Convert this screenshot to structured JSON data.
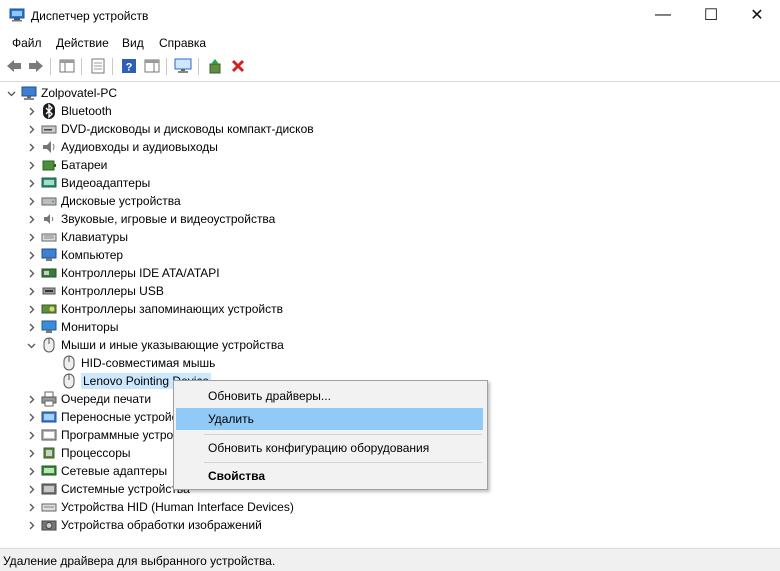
{
  "window": {
    "title": "Диспетчер устройств",
    "minimize": "—",
    "maximize": "☐",
    "close": "✕"
  },
  "menu": [
    "Файл",
    "Действие",
    "Вид",
    "Справка"
  ],
  "tree": {
    "root": "Zolpovatel-PC",
    "categories": [
      {
        "label": "Bluetooth",
        "icon": "bluetooth-icon"
      },
      {
        "label": "DVD-дисководы и дисководы компакт-дисков",
        "icon": "dvd-drive-icon"
      },
      {
        "label": "Аудиовходы и аудиовыходы",
        "icon": "speaker-icon"
      },
      {
        "label": "Батареи",
        "icon": "battery-icon"
      },
      {
        "label": "Видеоадаптеры",
        "icon": "display-adapter-icon"
      },
      {
        "label": "Дисковые устройства",
        "icon": "disk-drive-icon"
      },
      {
        "label": "Звуковые, игровые и видеоустройства",
        "icon": "sound-icon"
      },
      {
        "label": "Клавиатуры",
        "icon": "keyboard-icon"
      },
      {
        "label": "Компьютер",
        "icon": "computer-icon"
      },
      {
        "label": "Контроллеры IDE ATA/ATAPI",
        "icon": "ide-controller-icon"
      },
      {
        "label": "Контроллеры USB",
        "icon": "usb-icon"
      },
      {
        "label": "Контроллеры запоминающих устройств",
        "icon": "storage-controller-icon"
      },
      {
        "label": "Мониторы",
        "icon": "monitor-icon"
      },
      {
        "label": "Мыши и иные указывающие устройства",
        "icon": "mouse-icon",
        "expanded": true
      },
      {
        "label": "HID-совместимая мышь",
        "icon": "mouse-icon",
        "child": true
      },
      {
        "label": "Lenovo Pointing Device",
        "icon": "mouse-icon",
        "child": true,
        "selected": true
      },
      {
        "label": "Очереди печати",
        "icon": "printer-icon"
      },
      {
        "label": "Переносные устройства",
        "icon": "portable-device-icon"
      },
      {
        "label": "Программные устройства",
        "icon": "software-device-icon"
      },
      {
        "label": "Процессоры",
        "icon": "processor-icon"
      },
      {
        "label": "Сетевые адаптеры",
        "icon": "network-adapter-icon"
      },
      {
        "label": "Системные устройства",
        "icon": "system-device-icon"
      },
      {
        "label": "Устройства HID (Human Interface Devices)",
        "icon": "hid-icon"
      },
      {
        "label": "Устройства обработки изображений",
        "icon": "camera-icon"
      }
    ]
  },
  "context_menu": {
    "update": "Обновить драйверы...",
    "delete": "Удалить",
    "scan": "Обновить конфигурацию оборудования",
    "properties": "Свойства"
  },
  "status": "Удаление драйвера для выбранного устройства."
}
